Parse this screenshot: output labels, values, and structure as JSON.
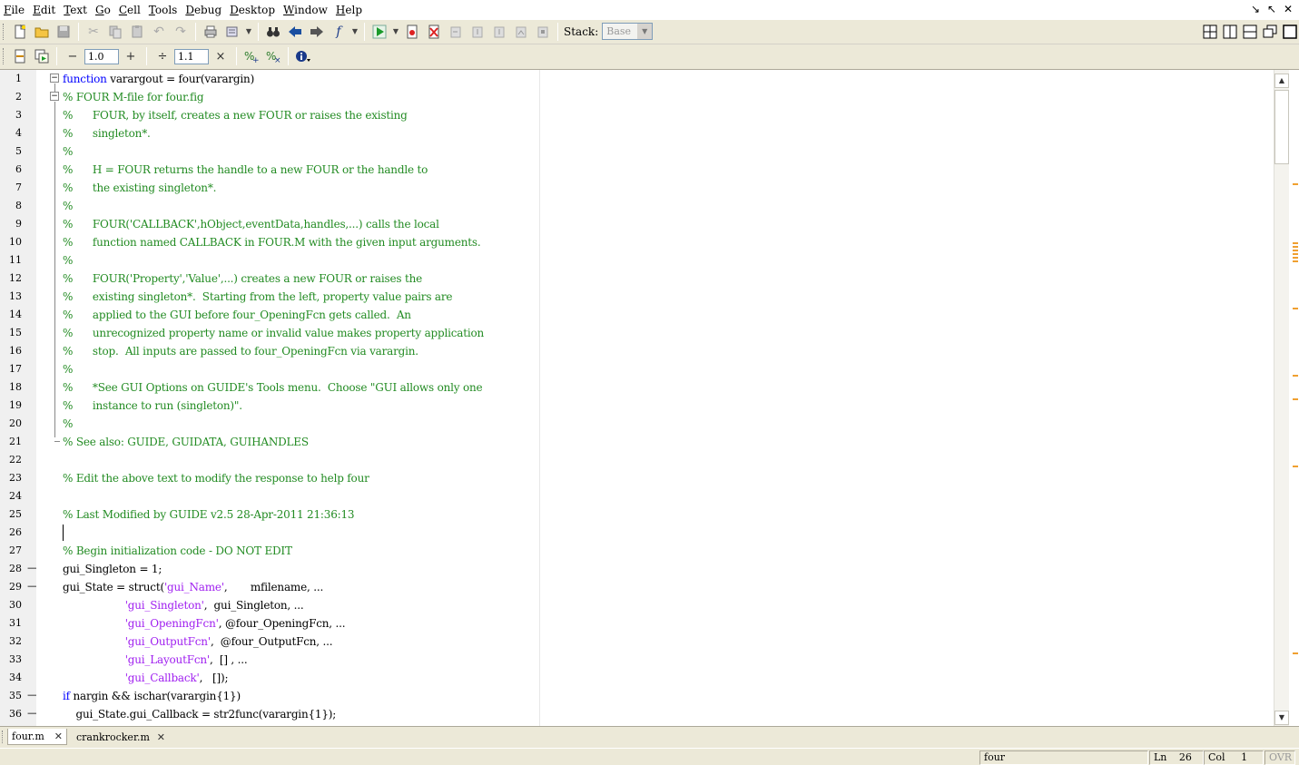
{
  "menu": [
    "File",
    "Edit",
    "Text",
    "Go",
    "Cell",
    "Tools",
    "Debug",
    "Desktop",
    "Window",
    "Help"
  ],
  "menu_mnemonics": [
    "F",
    "E",
    "T",
    "G",
    "C",
    "T",
    "D",
    "D",
    "W",
    "H"
  ],
  "toolbar": {
    "stack_label": "Stack:",
    "stack_value": "Base",
    "increment_value": "1.0",
    "divide_value": "1.1",
    "minus_symbol": "−",
    "plus_symbol": "+",
    "divide_symbol": "÷",
    "times_symbol": "×"
  },
  "editor": {
    "first_line_number": 1,
    "caret_line": 26,
    "lines": [
      [
        {
          "t": "function",
          "c": "kw"
        },
        {
          "t": " varargout = four(varargin)"
        }
      ],
      [
        {
          "t": "% FOUR M-file for four.fig",
          "c": "cm"
        }
      ],
      [
        {
          "t": "%      FOUR, by itself, creates a new FOUR or raises the existing",
          "c": "cm"
        }
      ],
      [
        {
          "t": "%      singleton*.",
          "c": "cm"
        }
      ],
      [
        {
          "t": "%",
          "c": "cm"
        }
      ],
      [
        {
          "t": "%      H = FOUR returns the handle to a new FOUR or the handle to",
          "c": "cm"
        }
      ],
      [
        {
          "t": "%      the existing singleton*.",
          "c": "cm"
        }
      ],
      [
        {
          "t": "%",
          "c": "cm"
        }
      ],
      [
        {
          "t": "%      FOUR('CALLBACK',hObject,eventData,handles,...) calls the local",
          "c": "cm"
        }
      ],
      [
        {
          "t": "%      function named CALLBACK in FOUR.M with the given input arguments.",
          "c": "cm"
        }
      ],
      [
        {
          "t": "%",
          "c": "cm"
        }
      ],
      [
        {
          "t": "%      FOUR('Property','Value',...) creates a new FOUR or raises the",
          "c": "cm"
        }
      ],
      [
        {
          "t": "%      existing singleton*.  Starting from the left, property value pairs are",
          "c": "cm"
        }
      ],
      [
        {
          "t": "%      applied to the GUI before four_OpeningFcn gets called.  An",
          "c": "cm"
        }
      ],
      [
        {
          "t": "%      unrecognized property name or invalid value makes property application",
          "c": "cm"
        }
      ],
      [
        {
          "t": "%      stop.  All inputs are passed to four_OpeningFcn via varargin.",
          "c": "cm"
        }
      ],
      [
        {
          "t": "%",
          "c": "cm"
        }
      ],
      [
        {
          "t": "%      *See GUI Options on GUIDE's Tools menu.  Choose \"GUI allows only one",
          "c": "cm"
        }
      ],
      [
        {
          "t": "%      instance to run (singleton)\".",
          "c": "cm"
        }
      ],
      [
        {
          "t": "%",
          "c": "cm"
        }
      ],
      [
        {
          "t": "% See also: GUIDE, GUIDATA, GUIHANDLES",
          "c": "cm"
        }
      ],
      [],
      [
        {
          "t": "% Edit the above text to modify the response to help four",
          "c": "cm"
        }
      ],
      [],
      [
        {
          "t": "% Last Modified by GUIDE v2.5 28-Apr-2011 21:36:13",
          "c": "cm"
        }
      ],
      [],
      [
        {
          "t": "% Begin initialization code - DO NOT EDIT",
          "c": "cm"
        }
      ],
      [
        {
          "t": "gui_Singleton = 1;"
        }
      ],
      [
        {
          "t": "gui_State = struct("
        },
        {
          "t": "'gui_Name'",
          "c": "st"
        },
        {
          "t": ",       mfilename, ..."
        }
      ],
      [
        {
          "t": "                   "
        },
        {
          "t": "'gui_Singleton'",
          "c": "st"
        },
        {
          "t": ",  gui_Singleton, ..."
        }
      ],
      [
        {
          "t": "                   "
        },
        {
          "t": "'gui_OpeningFcn'",
          "c": "st"
        },
        {
          "t": ", @four_OpeningFcn, ..."
        }
      ],
      [
        {
          "t": "                   "
        },
        {
          "t": "'gui_OutputFcn'",
          "c": "st"
        },
        {
          "t": ",  @four_OutputFcn, ..."
        }
      ],
      [
        {
          "t": "                   "
        },
        {
          "t": "'gui_LayoutFcn'",
          "c": "st"
        },
        {
          "t": ",  [] , ..."
        }
      ],
      [
        {
          "t": "                   "
        },
        {
          "t": "'gui_Callback'",
          "c": "st"
        },
        {
          "t": ",   []);"
        }
      ],
      [
        {
          "t": "if",
          "c": "kw"
        },
        {
          "t": " nargin && ischar(varargin{1})"
        }
      ],
      [
        {
          "t": "    gui_State.gui_Callback = str2func(varargin{1});"
        }
      ]
    ],
    "executable_lines": [
      28,
      29,
      35,
      36
    ]
  },
  "tabs": [
    {
      "label": "four.m",
      "active": true
    },
    {
      "label": "crankrocker.m",
      "active": false
    }
  ],
  "status": {
    "function_name": "four",
    "ln_label": "Ln",
    "ln_value": "26",
    "col_label": "Col",
    "col_value": "1",
    "ovr": "OVR"
  },
  "colors": {
    "keyword": "#0000ff",
    "comment": "#228b22",
    "string": "#a020f0"
  }
}
